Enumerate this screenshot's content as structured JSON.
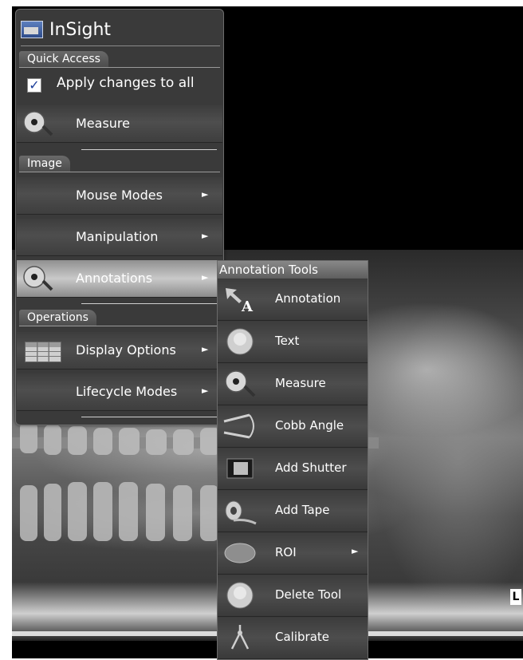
{
  "app": {
    "title": "InSight"
  },
  "viewer": {
    "orientation_marker": "L"
  },
  "sections": {
    "quick_access": "Quick Access",
    "image": "Image",
    "operations": "Operations"
  },
  "quick_access": {
    "apply_all_label": "Apply changes to all",
    "apply_all_checked": true,
    "measure_label": "Measure"
  },
  "image_menu": {
    "mouse_modes": "Mouse Modes",
    "manipulation": "Manipulation",
    "annotations": "Annotations"
  },
  "operations_menu": {
    "display_options": "Display Options",
    "lifecycle_modes": "Lifecycle Modes"
  },
  "submenu": {
    "title": "Annotation Tools",
    "items": [
      {
        "label": "Annotation",
        "icon": "annotation-arrow-icon"
      },
      {
        "label": "Text",
        "icon": "skull-icon"
      },
      {
        "label": "Measure",
        "icon": "tape-measure-icon"
      },
      {
        "label": "Cobb Angle",
        "icon": "cobb-angle-icon"
      },
      {
        "label": "Add Shutter",
        "icon": "shutter-icon"
      },
      {
        "label": "Add Tape",
        "icon": "tape-roll-icon"
      },
      {
        "label": "ROI",
        "icon": "ellipse-icon"
      },
      {
        "label": "Delete Tool",
        "icon": "skull-icon"
      },
      {
        "label": "Calibrate",
        "icon": "caliper-icon"
      }
    ]
  },
  "colors": {
    "panel_bg": "#3a3a3a",
    "active_row": "#c9c9c9",
    "text": "#ffffff",
    "viewer_bg": "#000000"
  }
}
